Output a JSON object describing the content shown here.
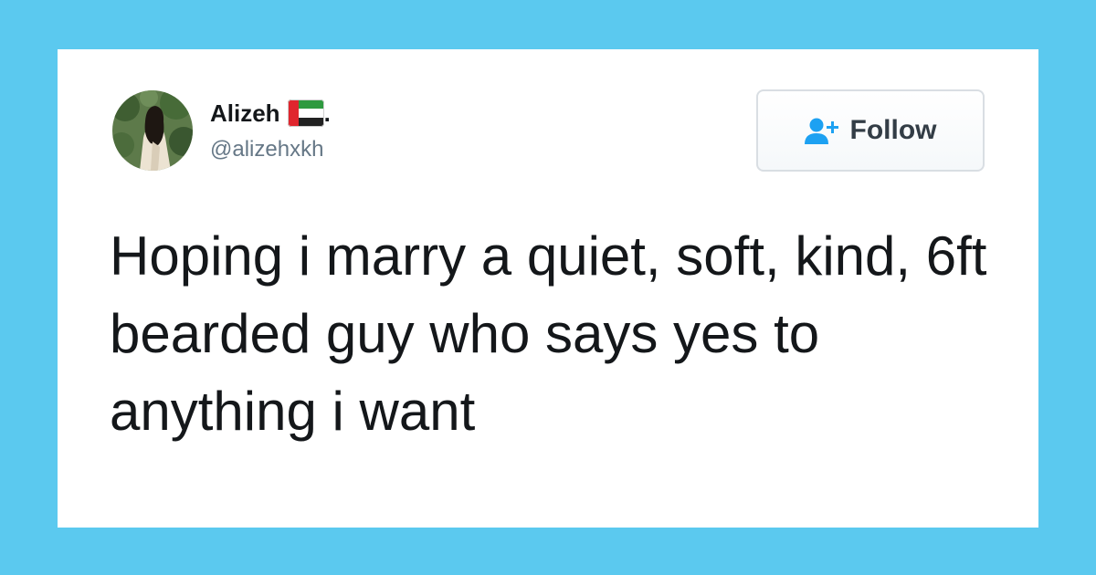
{
  "colors": {
    "background": "#5bc9ef",
    "card": "#ffffff",
    "follow_icon": "#1da1f2",
    "handle": "#657786"
  },
  "user": {
    "display_name": "Alizeh",
    "name_suffix": ".",
    "flag_icon": "uae-flag-icon",
    "handle": "@alizehxkh"
  },
  "follow_button": {
    "label": "Follow",
    "icon": "add-user-icon"
  },
  "tweet": {
    "text": "Hoping i marry a quiet, soft, kind, 6ft bearded guy who says yes to anything i want"
  }
}
